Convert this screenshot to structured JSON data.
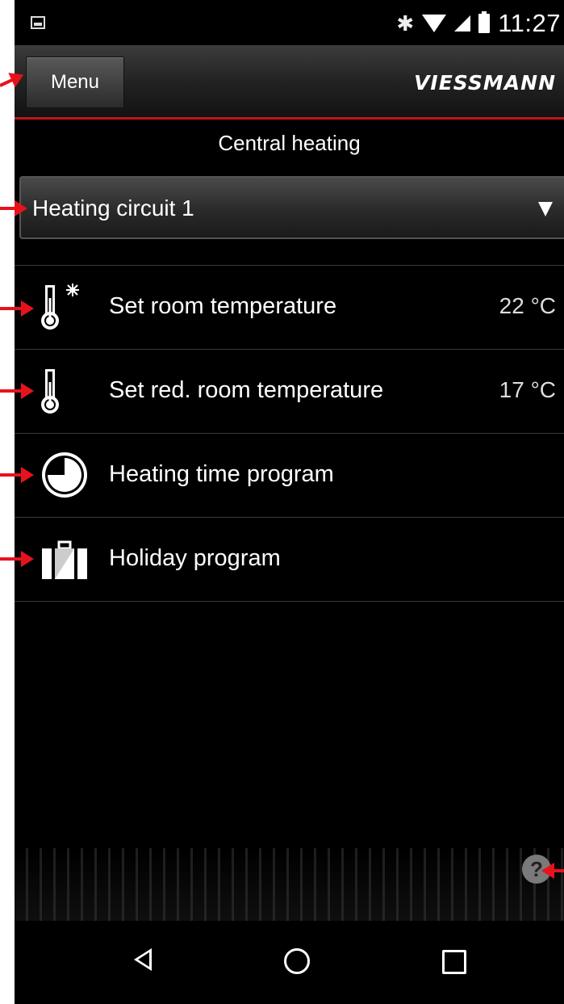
{
  "status_bar": {
    "time": "11:27"
  },
  "header": {
    "menu_label": "Menu",
    "logo": "VIESSMANN"
  },
  "page": {
    "title": "Central heating"
  },
  "selector": {
    "value": "Heating circuit 1"
  },
  "items": [
    {
      "icon": "thermometer-sun-icon",
      "label": "Set room temperature",
      "value": "22 °C"
    },
    {
      "icon": "thermometer-moon-icon",
      "label": "Set red. room temperature",
      "value": "17 °C"
    },
    {
      "icon": "clock-pie-icon",
      "label": "Heating time program",
      "value": ""
    },
    {
      "icon": "suitcase-icon",
      "label": "Holiday program",
      "value": ""
    }
  ],
  "help": {
    "glyph": "?"
  },
  "colors": {
    "accent": "#c0141c",
    "annotation": "#e8121c",
    "background": "#000000"
  }
}
